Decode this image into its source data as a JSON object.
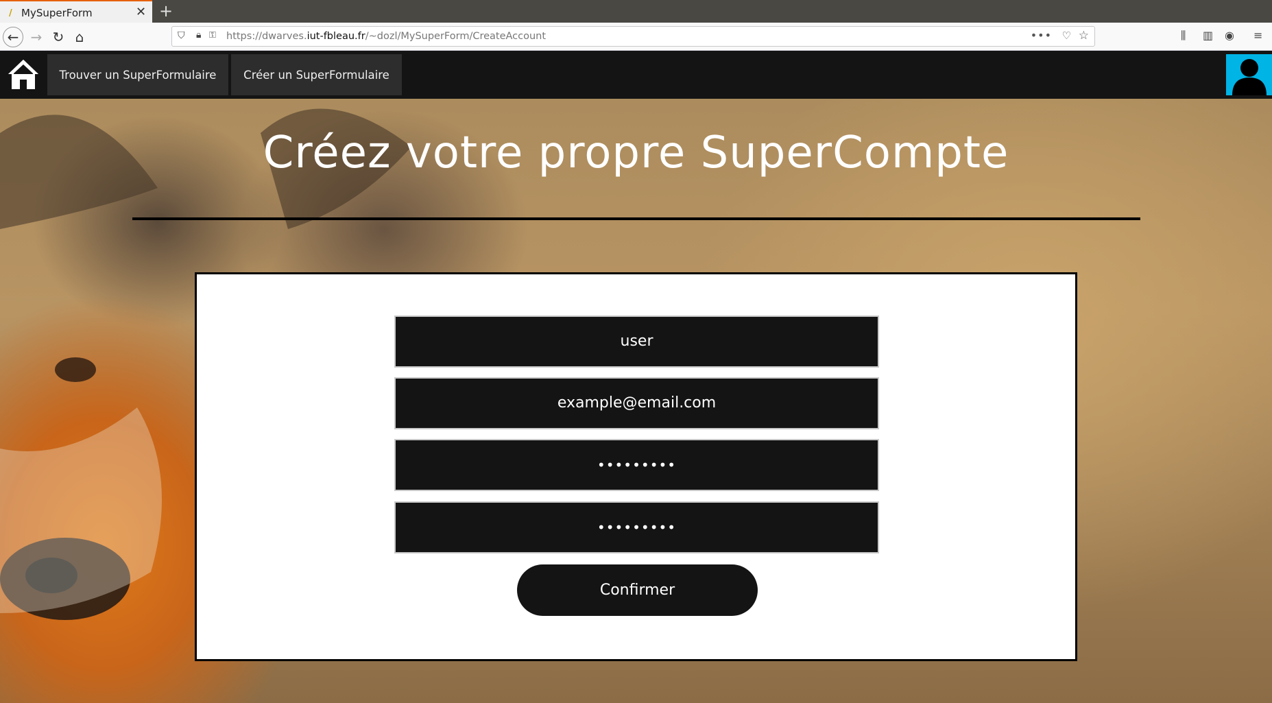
{
  "browser": {
    "tab_title": "MySuperForm",
    "url_prefix": "https://dwarves.",
    "url_domain": "iut-fbleau.fr",
    "url_path": "/~dozl/MySuperForm/CreateAccount"
  },
  "nav": {
    "items": [
      {
        "label": "Trouver un SuperFormulaire"
      },
      {
        "label": "Créer un SuperFormulaire"
      }
    ]
  },
  "page": {
    "title": "Créez votre propre SuperCompte"
  },
  "form": {
    "username": "user",
    "email": "example@email.com",
    "password": "•••••••••",
    "password_confirm": "•••••••••",
    "submit_label": "Confirmer"
  },
  "colors": {
    "navbar": "#141414",
    "avatar_bg": "#00b4e6",
    "field_bg": "#141414"
  }
}
